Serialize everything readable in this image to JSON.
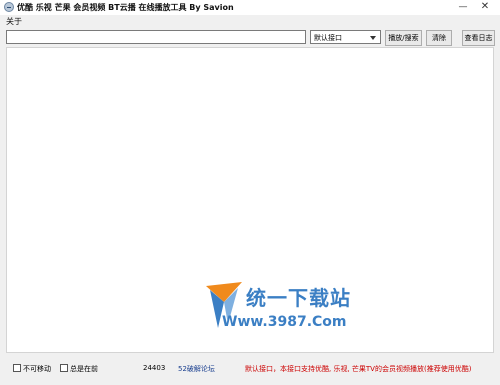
{
  "window": {
    "title": "优酷 乐视 芒果 会员视频 BT云播 在线播放工具 By Savion",
    "minimize_glyph": "—",
    "close_glyph": "✕"
  },
  "menu": {
    "about": "关于"
  },
  "toolbar": {
    "url_value": "",
    "interface_selected": "默认接口",
    "play_label": "播放/搜索",
    "clear_label": "清除",
    "log_label": "查看日志"
  },
  "watermark": {
    "brand_cn": "统一下载站",
    "brand_url": "Www.3987.Com"
  },
  "status": {
    "not_movable_label": "不可移动",
    "not_movable_checked": false,
    "always_on_top_label": "总是在前",
    "always_on_top_checked": false,
    "speed": "24403",
    "forum_link": "52破解论坛",
    "notice": "默认接口，本接口支持优酷, 乐视, 芒果TV的会员视频播放(推荐使用优酷)"
  }
}
